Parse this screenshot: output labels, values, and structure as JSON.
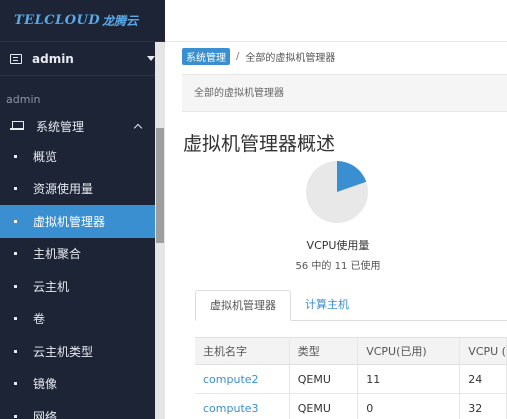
{
  "brand": {
    "logo_latin": "TELCLOUD",
    "logo_cn": "龙腾云"
  },
  "user": {
    "name": "admin"
  },
  "sidebar": {
    "section_label": "admin",
    "group_label": "系统管理",
    "items": [
      {
        "label": "概览",
        "active": false
      },
      {
        "label": "资源使用量",
        "active": false
      },
      {
        "label": "虚拟机管理器",
        "active": true
      },
      {
        "label": "主机聚合",
        "active": false
      },
      {
        "label": "云主机",
        "active": false
      },
      {
        "label": "卷",
        "active": false
      },
      {
        "label": "云主机类型",
        "active": false
      },
      {
        "label": "镜像",
        "active": false
      },
      {
        "label": "网络",
        "active": false
      }
    ]
  },
  "breadcrumb": {
    "tag": "系统管理",
    "separator": "/",
    "current": "全部的虚拟机管理器"
  },
  "subheader": {
    "text": "全部的虚拟机管理器"
  },
  "page": {
    "title": "虚拟机管理器概述"
  },
  "usage": {
    "label": "VCPU使用量",
    "summary": "56 中的 11 已使用",
    "used": 11,
    "total": 56
  },
  "tabs": [
    {
      "label": "虚拟机管理器",
      "active": true
    },
    {
      "label": "计算主机",
      "active": false
    }
  ],
  "table": {
    "columns": [
      "主机名字",
      "类型",
      "VCPU(已用)",
      "VCPU ("
    ],
    "rows": [
      {
        "host": "compute2",
        "type": "QEMU",
        "vcpu_used": "11",
        "vcpu_total": "24"
      },
      {
        "host": "compute3",
        "type": "QEMU",
        "vcpu_used": "0",
        "vcpu_total": "32"
      }
    ]
  },
  "colors": {
    "sidebar_bg": "#1c2435",
    "accent": "#3a8fd0",
    "pie_used": "#3a8fd0",
    "pie_free": "#e8e8e8"
  }
}
